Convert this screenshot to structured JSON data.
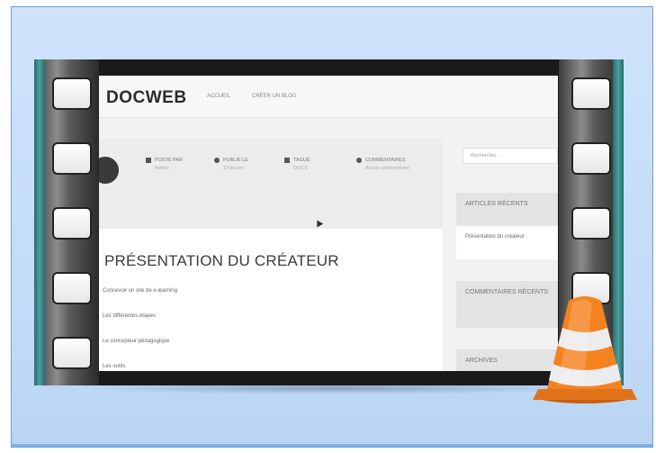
{
  "site": {
    "logo": "DOCWEB",
    "nav": [
      "ACCUEIL",
      "CRÉER UN BLOG"
    ]
  },
  "post_meta": [
    {
      "icon": "user-icon",
      "label": "POSTÉ PAR",
      "sub": "Admin"
    },
    {
      "icon": "clock-icon",
      "label": "PUBLIÉ LE",
      "sub": "10 février"
    },
    {
      "icon": "tag-icon",
      "label": "TAGUÉ",
      "sub": "DOCS"
    },
    {
      "icon": "comment-icon",
      "label": "COMMENTAIRES",
      "sub": "Aucun commentaire"
    }
  ],
  "article": {
    "title": "PRÉSENTATION DU CRÉATEUR",
    "lines": [
      "Concevoir un site de e-learning",
      "Les différentes étapes",
      "Le concepteur pédagogique",
      "Les outils"
    ]
  },
  "sidebar": {
    "search_placeholder": "Rechercher…",
    "recent_articles_title": "ARTICLES RÉCENTS",
    "recent_article": "Présentation du créateur",
    "recent_comments_title": "COMMENTAIRES RÉCENTS",
    "archives_title": "ARCHIVES"
  },
  "colors": {
    "frame_border": "#6d9ed6",
    "frame_bg": "#cfe3fb",
    "cone_orange": "#f58220"
  },
  "icons": {
    "overlay": "vlc-cone-icon"
  }
}
